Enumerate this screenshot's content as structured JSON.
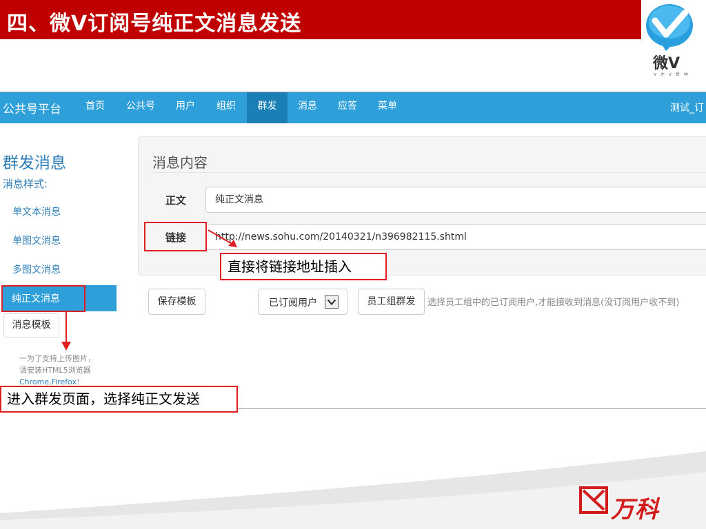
{
  "slide": {
    "title": "四、微V订阅号纯正文消息发送",
    "logo_text": "微V",
    "logo_subtitle": "V 才 V 世 林",
    "footer_brand": "万科"
  },
  "navbar": {
    "brand": "公共号平台",
    "items": [
      "首页",
      "公共号",
      "用户",
      "组织",
      "群发",
      "消息",
      "应答",
      "菜单"
    ],
    "active_item": "群发",
    "right_text": "测试_订"
  },
  "sidebar": {
    "title": "群发消息",
    "subtitle": "消息样式:",
    "items": [
      "单文本消息",
      "单图文消息",
      "多图文消息",
      "纯正文消息"
    ],
    "active_item": "纯正文消息",
    "template_button": "消息模板",
    "upload_note": {
      "text_before": "一为了支持上传图片，请安装HTML5浏览器",
      "link": "Chrome,Firefox",
      "text_after": "!"
    }
  },
  "panel": {
    "title": "消息内容",
    "fields": [
      {
        "label": "正文",
        "value": "纯正文消息"
      },
      {
        "label": "链接",
        "value": "http://news.sohu.com/20140321/n396982115.shtml"
      }
    ]
  },
  "actions": {
    "save_template": "保存模板",
    "select_value": "已订阅用户",
    "staff_group_send": "员工组群发",
    "hint": "选择员工组中的已订阅用户,才能接收到消息(没订阅用户收不到)"
  },
  "annotations": {
    "link_callout": "直接将链接地址插入",
    "sidebar_callout": "进入群发页面，选择纯正文发送"
  },
  "colors": {
    "title_bar": "#c00000",
    "nav_bar": "#2e9fd8",
    "nav_active": "#1a7fb5",
    "annotation_red": "#e02020",
    "brand_red": "#d21a1a"
  }
}
